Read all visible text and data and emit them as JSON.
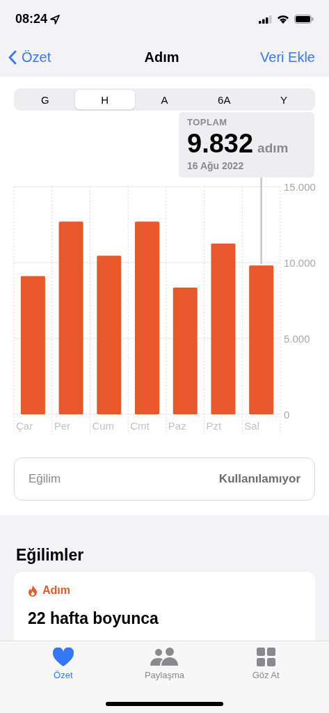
{
  "status_bar": {
    "time": "08:24"
  },
  "nav": {
    "back": "Özet",
    "title": "Adım",
    "action": "Veri Ekle"
  },
  "segments": [
    {
      "label": "G",
      "selected": false
    },
    {
      "label": "H",
      "selected": true
    },
    {
      "label": "A",
      "selected": false
    },
    {
      "label": "6A",
      "selected": false
    },
    {
      "label": "Y",
      "selected": false
    }
  ],
  "summary": {
    "title": "TOPLAM",
    "value": "9.832",
    "unit": "adım",
    "date": "16 Ağu 2022"
  },
  "chart_data": {
    "type": "bar",
    "categories": [
      "Çar",
      "Per",
      "Cum",
      "Cmt",
      "Paz",
      "Pzt",
      "Sal"
    ],
    "series": [
      {
        "color": "#e8582a",
        "values": [
          9100,
          12700,
          10450,
          12700,
          8350,
          11250,
          9800
        ]
      }
    ],
    "ylim": [
      0,
      15000
    ],
    "yticks": [
      {
        "value": 0,
        "label": "0"
      },
      {
        "value": 5000,
        "label": "5.000"
      },
      {
        "value": 10000,
        "label": "10.000"
      },
      {
        "value": 15000,
        "label": "15.000"
      }
    ]
  },
  "trend_row": {
    "label": "Eğilim",
    "value": "Kullanılamıyor"
  },
  "trends": {
    "heading": "Eğilimler",
    "card": {
      "tag": "Adım",
      "title": "22 hafta boyunca"
    }
  },
  "tab_bar": [
    {
      "label": "Özet",
      "kind": "heart",
      "selected": true
    },
    {
      "label": "Paylaşma",
      "kind": "people",
      "selected": false
    },
    {
      "label": "Göz At",
      "kind": "grid",
      "selected": false
    }
  ]
}
